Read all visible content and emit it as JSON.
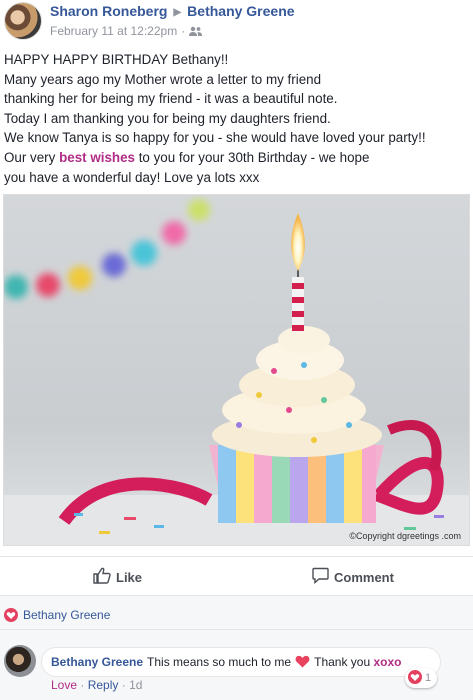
{
  "post": {
    "author": "Sharon Roneberg",
    "target": "Bethany Greene",
    "timestamp": "February 11 at 12:22pm",
    "privacy_icon": "friends-icon",
    "lines": [
      "HAPPY HAPPY BIRTHDAY Bethany!!",
      "Many years ago my Mother wrote a letter to my friend",
      "thanking her for being my friend - it was a beautiful note.",
      "Today I am thanking you for being my daughters friend.",
      "We know Tanya is so happy for you - she would have loved your party!!"
    ],
    "line6_before": "Our very ",
    "line6_highlight": "best wishes",
    "line6_after": " to you for your 30th Birthday - we hope",
    "line7": "you have a wonderful day! Love ya lots xxx",
    "photo_credit": "©Copyright dgreetings .com"
  },
  "actions": {
    "like_label": "Like",
    "comment_label": "Comment"
  },
  "reactions": {
    "icon": "heart-icon",
    "names": "Bethany Greene"
  },
  "comment": {
    "author": "Bethany Greene",
    "text_before": "This means so much to me",
    "text_after": "Thank you",
    "highlight": "xoxo",
    "love_label": "Love",
    "reply_label": "Reply",
    "age": "1d",
    "reaction_count": "1"
  },
  "colors": {
    "link_blue": "#365899",
    "highlight_pink": "#b12d86",
    "love_red": "#e4405f",
    "muted_gray": "#90949c"
  }
}
